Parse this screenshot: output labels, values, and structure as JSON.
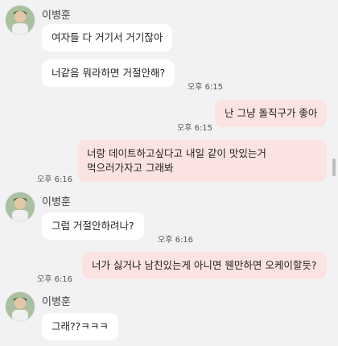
{
  "sender": {
    "name": "이병훈",
    "avatar": "avatar-person-icon"
  },
  "messages": [
    {
      "dir": "in",
      "text": "여자들 다 거기서 거기잖아"
    },
    {
      "dir": "in",
      "text": "너같음 뭐라하면 거절안해?"
    },
    {
      "dir": "in_time",
      "text": "오후 6:15"
    },
    {
      "dir": "out",
      "text": "난 그냥 돌직구가 좋아"
    },
    {
      "dir": "out_time",
      "text": "오후 6:15"
    },
    {
      "dir": "out",
      "text_lines": [
        "너랑 데이트하고싶다고 내일 같이 맛있는거",
        "먹으러가자고 그래봐"
      ]
    },
    {
      "dir": "out_time",
      "text": "오후 6:16"
    },
    {
      "dir": "in",
      "text": "그럼 거절안하려나?"
    },
    {
      "dir": "in_time",
      "text": "오후 6:16"
    },
    {
      "dir": "out",
      "text": "너가 싫거나 남친있는게 아니면 웬만하면 오케이할듯?"
    },
    {
      "dir": "out_time",
      "text": "오후 6:16"
    },
    {
      "dir": "in",
      "text": "그래??ㅋㅋㅋ"
    }
  ],
  "colors": {
    "background": "#f2f2f4",
    "incoming_bubble": "#ffffff",
    "outgoing_bubble": "#fbe3e1"
  }
}
